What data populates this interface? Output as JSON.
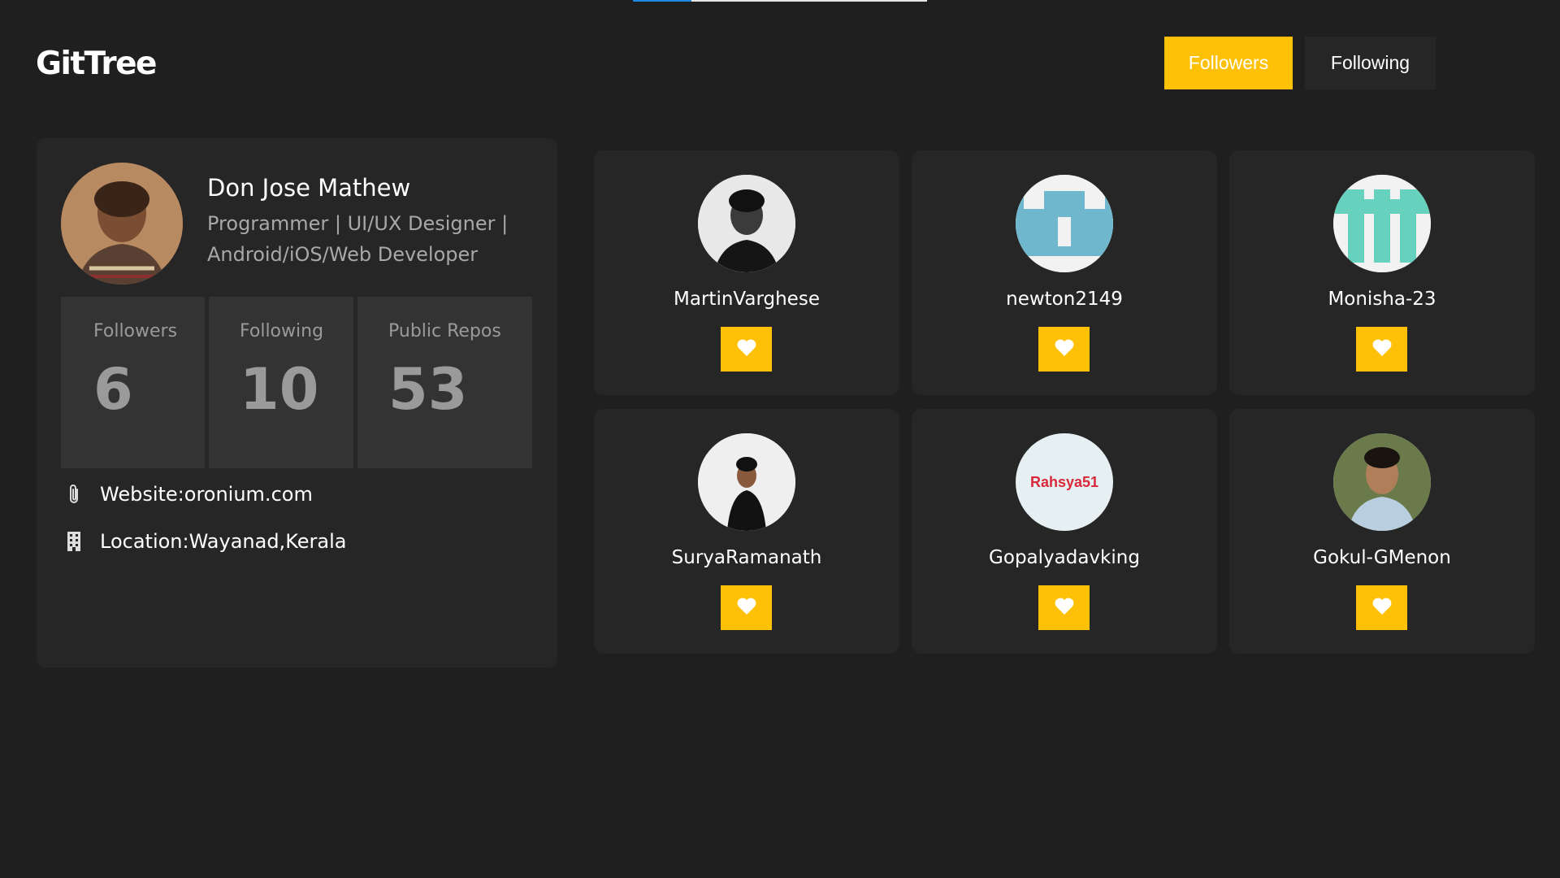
{
  "app": {
    "title": "GitTree"
  },
  "load_progress": 0.2,
  "tabs": [
    {
      "label": "Followers",
      "active": true
    },
    {
      "label": "Following",
      "active": false
    }
  ],
  "profile": {
    "name": "Don Jose Mathew",
    "bio": "Programmer | UI/UX Designer | Android/iOS/Web Developer",
    "stats": [
      {
        "label": "Followers",
        "value": "6"
      },
      {
        "label": "Following",
        "value": "10"
      },
      {
        "label": "Public Repos",
        "value": "53"
      }
    ],
    "website": "Website:oronium.com",
    "location": "Location:Wayanad,Kerala"
  },
  "users": [
    {
      "name": "MartinVarghese"
    },
    {
      "name": "newton2149"
    },
    {
      "name": "Monisha-23"
    },
    {
      "name": "SuryaRamanath"
    },
    {
      "name": "Gopalyadavking",
      "avatar_text": "Rahsya51"
    },
    {
      "name": "Gokul-GMenon"
    }
  ],
  "colors": {
    "background": "#1f1f1f",
    "card": "#262626",
    "accent": "#ffc107",
    "stat_bg": "#333333",
    "muted": "#a8a8a8"
  },
  "icons": {
    "website": "paperclip-icon",
    "location": "building-icon",
    "like": "heart-icon"
  }
}
